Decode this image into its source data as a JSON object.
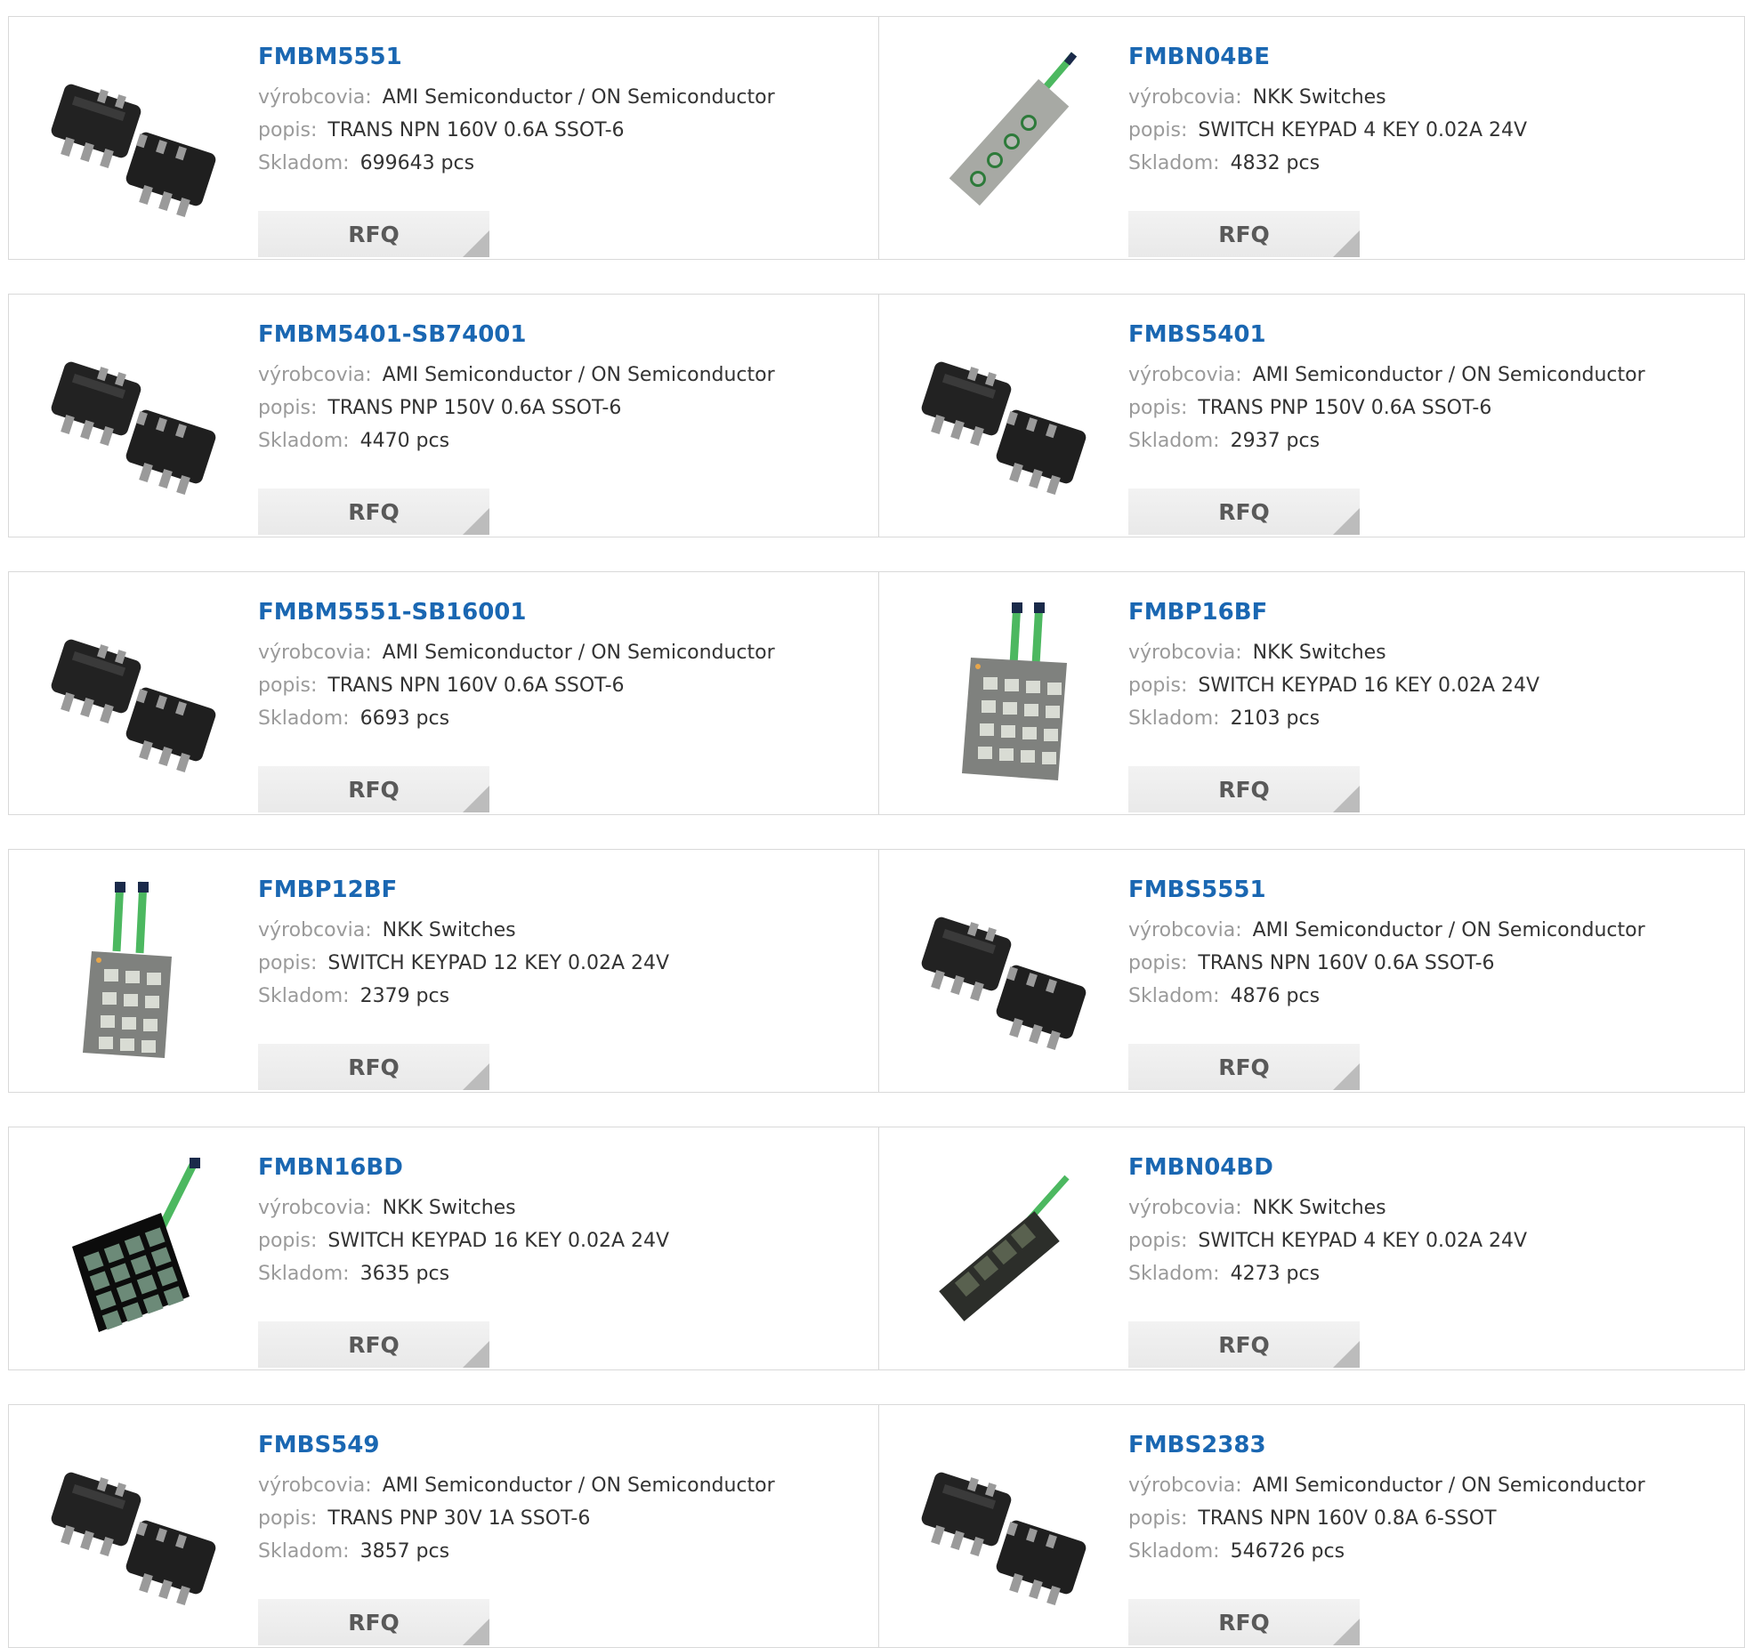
{
  "labels": {
    "manufacturer": "výrobcovia:",
    "description": "popis:",
    "stock": "Skladom:",
    "rfq": "RFQ"
  },
  "colors": {
    "title": "#1a67b2",
    "label": "#9a9a9a",
    "button_bg": "#eeeeee",
    "border": "#d9d9d9"
  },
  "products": [
    {
      "part": "FMBM5551",
      "manufacturer": "AMI Semiconductor / ON Semiconductor",
      "description": "TRANS NPN 160V 0.6A SSOT-6",
      "stock": "699643 pcs",
      "image": "sot-chip-icon"
    },
    {
      "part": "FMBN04BE",
      "manufacturer": "NKK Switches",
      "description": "SWITCH KEYPAD 4 KEY 0.02A 24V",
      "stock": "4832 pcs",
      "image": "keypad-strip-gray-icon"
    },
    {
      "part": "FMBM5401-SB74001",
      "manufacturer": "AMI Semiconductor / ON Semiconductor",
      "description": "TRANS PNP 150V 0.6A SSOT-6",
      "stock": "4470 pcs",
      "image": "sot-chip-icon"
    },
    {
      "part": "FMBS5401",
      "manufacturer": "AMI Semiconductor / ON Semiconductor",
      "description": "TRANS PNP 150V 0.6A SSOT-6",
      "stock": "2937 pcs",
      "image": "sot-chip-icon"
    },
    {
      "part": "FMBM5551-SB16001",
      "manufacturer": "AMI Semiconductor / ON Semiconductor",
      "description": "TRANS NPN 160V 0.6A SSOT-6",
      "stock": "6693 pcs",
      "image": "sot-chip-icon"
    },
    {
      "part": "FMBP16BF",
      "manufacturer": "NKK Switches",
      "description": "SWITCH KEYPAD 16 KEY 0.02A 24V",
      "stock": "2103 pcs",
      "image": "keypad-16-gray-icon"
    },
    {
      "part": "FMBP12BF",
      "manufacturer": "NKK Switches",
      "description": "SWITCH KEYPAD 12 KEY 0.02A 24V",
      "stock": "2379 pcs",
      "image": "keypad-12-gray-icon"
    },
    {
      "part": "FMBS5551",
      "manufacturer": "AMI Semiconductor / ON Semiconductor",
      "description": "TRANS NPN 160V 0.6A SSOT-6",
      "stock": "4876 pcs",
      "image": "sot-chip-icon"
    },
    {
      "part": "FMBN16BD",
      "manufacturer": "NKK Switches",
      "description": "SWITCH KEYPAD 16 KEY 0.02A 24V",
      "stock": "3635 pcs",
      "image": "keypad-16-black-icon"
    },
    {
      "part": "FMBN04BD",
      "manufacturer": "NKK Switches",
      "description": "SWITCH KEYPAD 4 KEY 0.02A 24V",
      "stock": "4273 pcs",
      "image": "keypad-strip-black-icon"
    },
    {
      "part": "FMBS549",
      "manufacturer": "AMI Semiconductor / ON Semiconductor",
      "description": "TRANS PNP 30V 1A SSOT-6",
      "stock": "3857 pcs",
      "image": "sot-chip-icon"
    },
    {
      "part": "FMBS2383",
      "manufacturer": "AMI Semiconductor / ON Semiconductor",
      "description": "TRANS NPN 160V 0.8A 6-SSOT",
      "stock": "546726 pcs",
      "image": "sot-chip-icon"
    }
  ]
}
